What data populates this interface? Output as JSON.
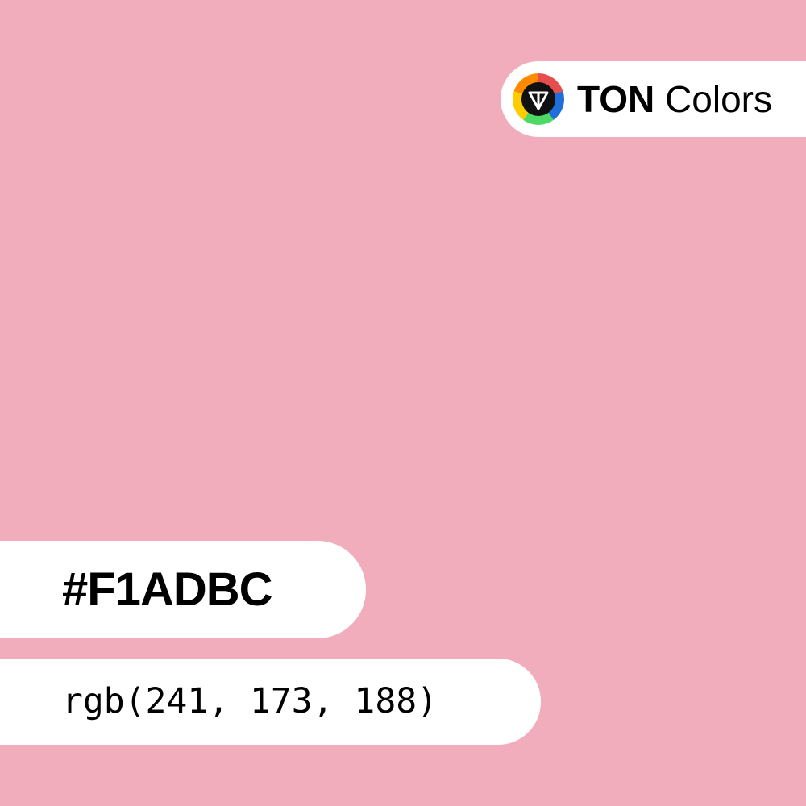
{
  "swatch": {
    "color": "#F1ADBC"
  },
  "brand": {
    "logo_icon": "ton-diamond-icon",
    "logo_ring_colors": [
      "#E84D4D",
      "#1E6FD9",
      "#4CD964",
      "#FFCC00",
      "#FF8A00"
    ],
    "name_bold": "TON",
    "name_light": "Colors"
  },
  "color_info": {
    "hex": "#F1ADBC",
    "rgb": "rgb(241, 173, 188)"
  }
}
